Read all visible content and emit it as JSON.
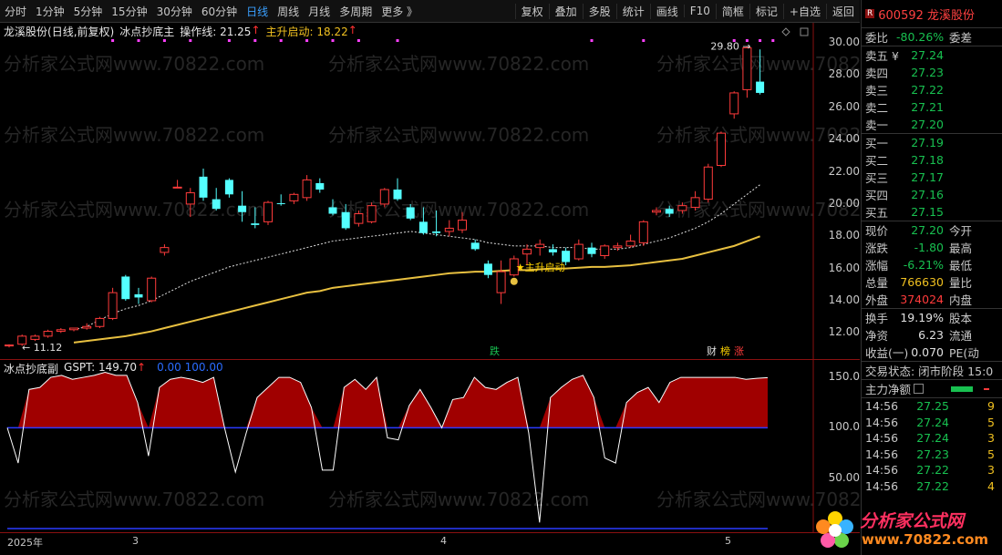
{
  "toolbar": {
    "items": [
      "分时",
      "1分钟",
      "5分钟",
      "15分钟",
      "30分钟",
      "60分钟",
      "日线",
      "周线",
      "月线",
      "多周期",
      "更多 》"
    ],
    "right_items": [
      "复权",
      "叠加",
      "多股",
      "统计",
      "画线",
      "F10",
      "简框",
      "标记",
      "+自选",
      "返回"
    ]
  },
  "chart": {
    "stock_name": "龙溪股份",
    "mode": "(日线,前复权)",
    "indicator": "冰点抄底主",
    "op_label": "操作线: 21.25",
    "op_arrow": "↑",
    "start_label": "主升启动: 18.22",
    "start_arrow": "↑",
    "annotation_start": "★主升启动",
    "peak_label": "29.80",
    "low_label": "11.12",
    "tag_die": "跌",
    "tag_cai": "财",
    "tag_bang": "榜",
    "tag_zhang": "涨",
    "y_ticks": [
      "30.00",
      "28.00",
      "26.00",
      "24.00",
      "22.00",
      "20.00",
      "18.00",
      "16.00",
      "14.00",
      "12.00"
    ],
    "sub_indicator": "冰点抄底副",
    "sub_value": "GSPT: 149.70",
    "sub_arrow": "↑",
    "sub_ref": "0.00 100.00",
    "sub_ticks": [
      "150.0",
      "100.0",
      "50.00"
    ],
    "x_ticks": [
      "2025年",
      "3",
      "4",
      "5"
    ],
    "watermarks": [
      "分析家公式网www.70822.com",
      "分析家公式网www.70822.com",
      "分析家公式网www.70822.com"
    ]
  },
  "sidebar": {
    "code_name": "600592 龙溪股份",
    "r_badge": "R",
    "weibi": {
      "label": "委比",
      "value": "-80.26%",
      "extra": "委差"
    },
    "asks": [
      {
        "label": "卖五 ¥",
        "price": "27.24"
      },
      {
        "label": "卖四",
        "price": "27.23"
      },
      {
        "label": "卖三",
        "price": "27.22"
      },
      {
        "label": "卖二",
        "price": "27.21"
      },
      {
        "label": "卖一",
        "price": "27.20"
      }
    ],
    "bids": [
      {
        "label": "买一",
        "price": "27.19"
      },
      {
        "label": "买二",
        "price": "27.18"
      },
      {
        "label": "买三",
        "price": "27.17"
      },
      {
        "label": "买四",
        "price": "27.16"
      },
      {
        "label": "买五",
        "price": "27.15"
      }
    ],
    "quote": [
      {
        "label": "现价",
        "value": "27.20",
        "extra": "今开",
        "color": "green"
      },
      {
        "label": "涨跌",
        "value": "-1.80",
        "extra": "最高",
        "color": "green"
      },
      {
        "label": "涨幅",
        "value": "-6.21%",
        "extra": "最低",
        "color": "green"
      },
      {
        "label": "总量",
        "value": "766630",
        "extra": "量比",
        "color": "yellow"
      },
      {
        "label": "外盘",
        "value": "374024",
        "extra": "内盘",
        "color": "red"
      }
    ],
    "stats": [
      {
        "label": "换手",
        "value": "19.19%",
        "extra": "股本"
      },
      {
        "label": "净资",
        "value": "6.23",
        "extra": "流通"
      },
      {
        "label": "收益(一)",
        "value": "0.070",
        "extra": "PE(动"
      }
    ],
    "status": "交易状态: 闭市阶段 15:0",
    "main_flow": "主力净额",
    "ticks": [
      {
        "time": "14:56",
        "price": "27.25",
        "vol": "9"
      },
      {
        "time": "14:56",
        "price": "27.24",
        "vol": "5"
      },
      {
        "time": "14:56",
        "price": "27.24",
        "vol": "3"
      },
      {
        "time": "14:56",
        "price": "27.23",
        "vol": "5"
      },
      {
        "time": "14:56",
        "price": "27.22",
        "vol": "3"
      },
      {
        "time": "14:56",
        "price": "27.22",
        "vol": "4"
      }
    ],
    "logo_text": "分析家公式网",
    "logo_url": "www.70822.com"
  },
  "chart_data": {
    "type": "candlestick",
    "y_range": [
      11,
      30.8
    ],
    "candles": [
      [
        11.2,
        11.3,
        11.1,
        11.25
      ],
      [
        11.3,
        11.9,
        11.2,
        11.8
      ],
      [
        11.6,
        11.9,
        11.5,
        11.8
      ],
      [
        11.8,
        12.2,
        11.7,
        12.1
      ],
      [
        12.1,
        12.3,
        12.0,
        12.2
      ],
      [
        12.2,
        12.3,
        12.1,
        12.3
      ],
      [
        12.3,
        12.6,
        12.2,
        12.4
      ],
      [
        12.4,
        13.0,
        12.3,
        12.9
      ],
      [
        12.9,
        14.8,
        12.8,
        14.5
      ],
      [
        15.5,
        15.6,
        14.0,
        14.1
      ],
      [
        14.4,
        14.8,
        13.8,
        14.2
      ],
      [
        14.0,
        15.5,
        13.9,
        15.4
      ],
      [
        17.0,
        17.5,
        16.8,
        17.3
      ],
      [
        21.0,
        21.5,
        21.0,
        21.05
      ],
      [
        20.0,
        21.0,
        19.2,
        20.7
      ],
      [
        21.7,
        22.2,
        20.2,
        20.4
      ],
      [
        20.3,
        21.0,
        19.6,
        19.7
      ],
      [
        21.5,
        21.6,
        20.4,
        20.6
      ],
      [
        19.9,
        20.8,
        18.9,
        19.5
      ],
      [
        18.8,
        19.8,
        18.5,
        18.7
      ],
      [
        18.9,
        20.2,
        18.7,
        20.1
      ],
      [
        20.05,
        20.6,
        19.9,
        20.0
      ],
      [
        20.2,
        20.7,
        20.0,
        20.6
      ],
      [
        20.4,
        21.8,
        20.2,
        21.5
      ],
      [
        21.3,
        21.6,
        20.7,
        20.9
      ],
      [
        19.8,
        20.3,
        19.3,
        19.4
      ],
      [
        19.5,
        20.0,
        18.4,
        18.5
      ],
      [
        18.8,
        19.6,
        18.6,
        19.4
      ],
      [
        18.9,
        20.1,
        18.8,
        19.9
      ],
      [
        20.0,
        21.0,
        19.8,
        20.9
      ],
      [
        20.9,
        21.6,
        20.2,
        20.3
      ],
      [
        19.8,
        20.0,
        19.0,
        19.1
      ],
      [
        18.9,
        19.8,
        18.1,
        18.2
      ],
      [
        18.3,
        19.6,
        18.0,
        18.2
      ],
      [
        18.3,
        19.0,
        18.0,
        18.5
      ],
      [
        18.4,
        19.5,
        18.2,
        19.0
      ],
      [
        17.6,
        17.8,
        17.1,
        17.2
      ],
      [
        16.3,
        16.5,
        15.4,
        15.6
      ],
      [
        14.5,
        16.5,
        13.8,
        15.8
      ],
      [
        15.6,
        16.8,
        15.5,
        16.6
      ],
      [
        16.9,
        17.5,
        16.2,
        17.2
      ],
      [
        17.3,
        17.8,
        16.8,
        17.5
      ],
      [
        17.2,
        17.5,
        16.8,
        17.0
      ],
      [
        17.1,
        17.3,
        16.2,
        16.4
      ],
      [
        16.6,
        17.8,
        16.5,
        17.5
      ],
      [
        17.3,
        17.6,
        16.7,
        16.9
      ],
      [
        16.8,
        17.5,
        16.6,
        17.4
      ],
      [
        17.3,
        17.6,
        17.1,
        17.4
      ],
      [
        17.4,
        18.1,
        17.3,
        17.7
      ],
      [
        17.6,
        19.0,
        17.4,
        18.9
      ],
      [
        19.5,
        19.8,
        19.3,
        19.6
      ],
      [
        19.7,
        19.9,
        19.2,
        19.4
      ],
      [
        19.6,
        20.1,
        19.4,
        19.9
      ],
      [
        19.8,
        20.8,
        19.6,
        20.4
      ],
      [
        20.3,
        22.5,
        20.1,
        22.3
      ],
      [
        22.4,
        24.5,
        22.3,
        24.4
      ],
      [
        25.6,
        27.0,
        25.3,
        26.9
      ],
      [
        27.1,
        29.8,
        26.6,
        29.7
      ],
      [
        27.6,
        29.6,
        26.8,
        26.9
      ]
    ],
    "ma_white": [
      11.2,
      11.3,
      11.5,
      11.7,
      11.9,
      12.2,
      12.4,
      12.8,
      13.2,
      13.5,
      13.7,
      14.0,
      14.4,
      14.8,
      15.2,
      15.5,
      15.8,
      16.1,
      16.3,
      16.5,
      16.7,
      16.9,
      17.1,
      17.3,
      17.5,
      17.7,
      17.8,
      17.9,
      18.0,
      18.1,
      18.2,
      18.3,
      18.2,
      18.1,
      18.0,
      17.9,
      17.8,
      17.6,
      17.5,
      17.4,
      17.4,
      17.4,
      17.3,
      17.3,
      17.3,
      17.2,
      17.2,
      17.2,
      17.3,
      17.5,
      17.7,
      17.9,
      18.2,
      18.5,
      18.9,
      19.4,
      20.0,
      20.6,
      21.2
    ],
    "ma_yellow": [
      11.0,
      11.05,
      11.1,
      11.2,
      11.3,
      11.4,
      11.5,
      11.6,
      11.7,
      11.8,
      11.95,
      12.1,
      12.3,
      12.5,
      12.7,
      12.9,
      13.1,
      13.3,
      13.5,
      13.7,
      13.9,
      14.1,
      14.3,
      14.5,
      14.6,
      14.8,
      14.9,
      15.0,
      15.1,
      15.2,
      15.3,
      15.4,
      15.5,
      15.6,
      15.7,
      15.75,
      15.8,
      15.8,
      15.85,
      15.9,
      15.9,
      15.95,
      16.0,
      16.0,
      16.05,
      16.1,
      16.1,
      16.15,
      16.2,
      16.3,
      16.4,
      16.5,
      16.6,
      16.8,
      17.0,
      17.2,
      17.4,
      17.7,
      18.0
    ],
    "sub_range": [
      0,
      160
    ],
    "gspt": [
      100,
      65,
      138,
      140,
      150,
      152,
      148,
      150,
      152,
      155,
      152,
      152,
      125,
      72,
      140,
      148,
      150,
      148,
      145,
      150,
      100,
      56,
      95,
      130,
      140,
      150,
      150,
      145,
      120,
      58,
      58,
      140,
      148,
      138,
      150,
      90,
      88,
      122,
      138,
      120,
      100,
      128,
      130,
      150,
      140,
      138,
      145,
      150,
      95,
      6,
      130,
      140,
      148,
      152,
      130,
      70,
      65,
      125,
      135,
      140,
      125,
      145,
      150,
      150,
      150,
      150,
      150,
      150,
      148,
      149,
      149.7
    ]
  }
}
